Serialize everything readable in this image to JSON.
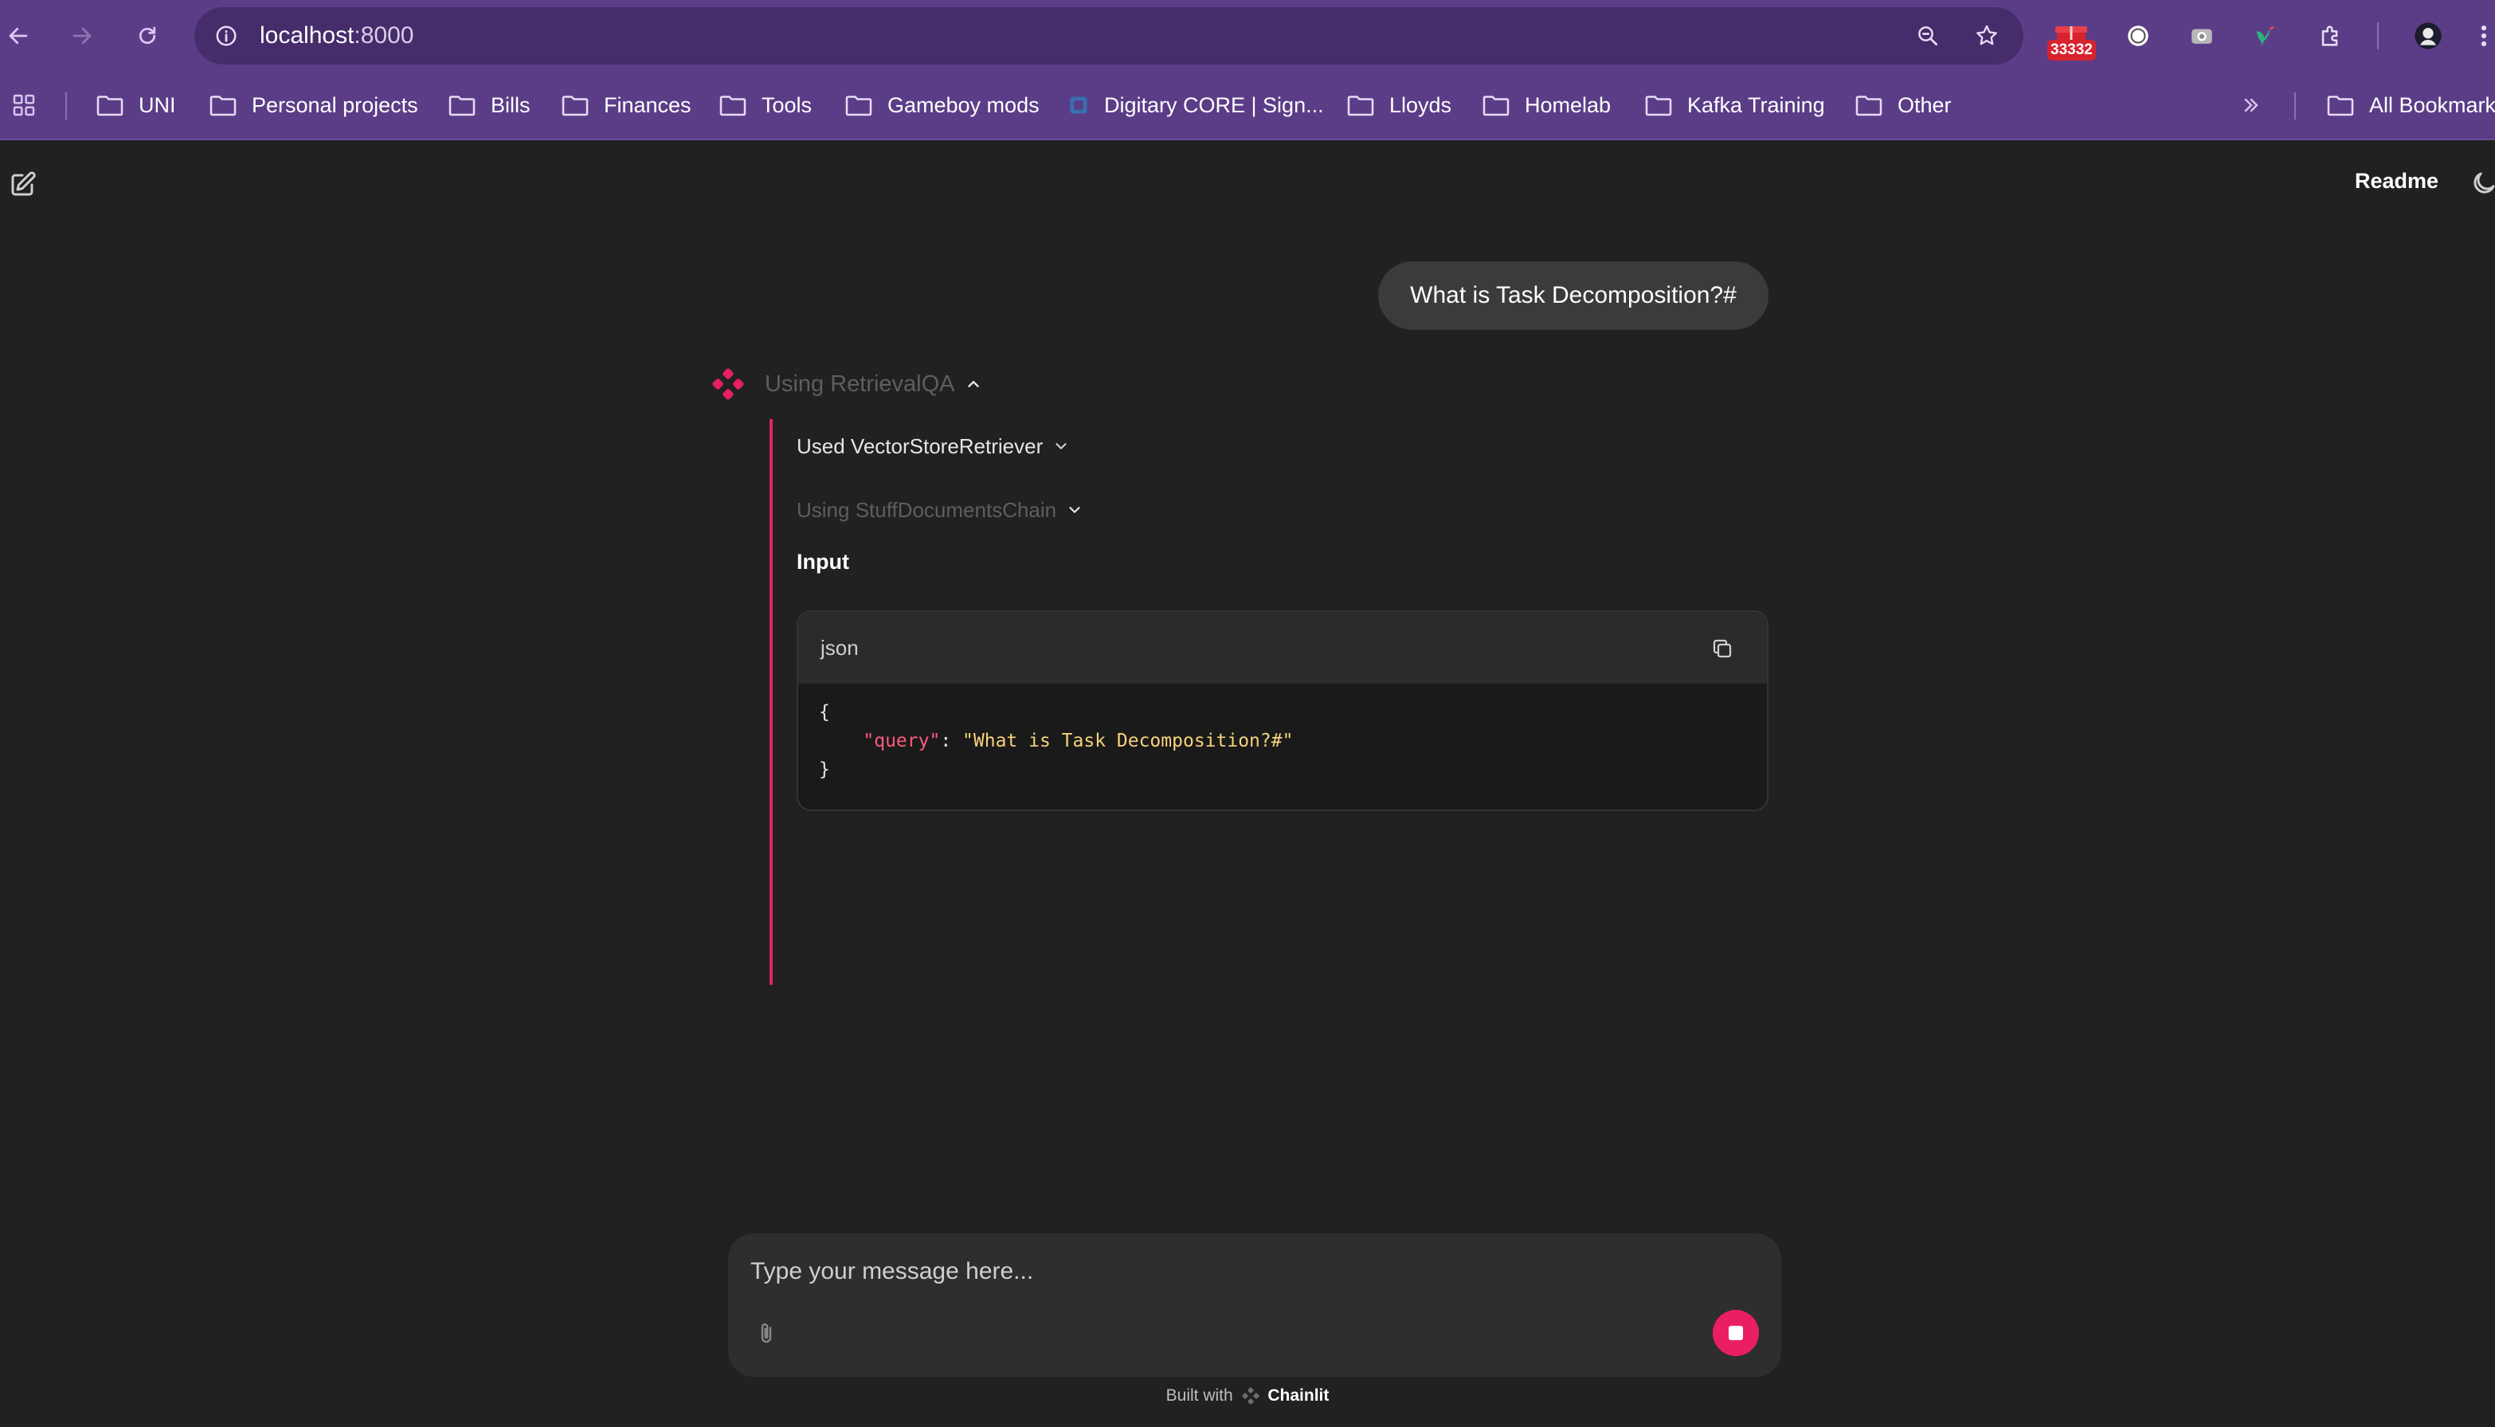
{
  "browser": {
    "url_host": "localhost",
    "url_port": ":8000",
    "extension_badge": "33332",
    "bookmarks": [
      {
        "label": "UNI",
        "type": "folder"
      },
      {
        "label": "Personal projects",
        "type": "folder"
      },
      {
        "label": "Bills",
        "type": "folder"
      },
      {
        "label": "Finances",
        "type": "folder"
      },
      {
        "label": "Tools",
        "type": "folder"
      },
      {
        "label": "Gameboy mods",
        "type": "folder"
      },
      {
        "label": "Digitary CORE | Sign...",
        "type": "site"
      },
      {
        "label": "Lloyds",
        "type": "folder"
      },
      {
        "label": "Homelab",
        "type": "folder"
      },
      {
        "label": "Kafka Training",
        "type": "folder"
      },
      {
        "label": "Other",
        "type": "folder"
      }
    ],
    "all_bookmarks": "All Bookmark",
    "chrome_color": "#5b3d87"
  },
  "app": {
    "readme_label": "Readme",
    "user_message": "What is Task Decomposition?#",
    "root_step": "Using RetrievalQA",
    "sub_steps": [
      {
        "label": "Used VectorStoreRetriever"
      },
      {
        "label": "Using StuffDocumentsChain"
      }
    ],
    "input_title": "Input",
    "code": {
      "lang": "json",
      "open_brace": "{",
      "key": "\"query\"",
      "colon": ": ",
      "value": "\"What is Task Decomposition?#\"",
      "close_brace": "}"
    },
    "composer_placeholder": "Type your message here...",
    "footer_prefix": "Built with",
    "footer_brand": "Chainlit",
    "accent_color": "#ea1f63"
  }
}
